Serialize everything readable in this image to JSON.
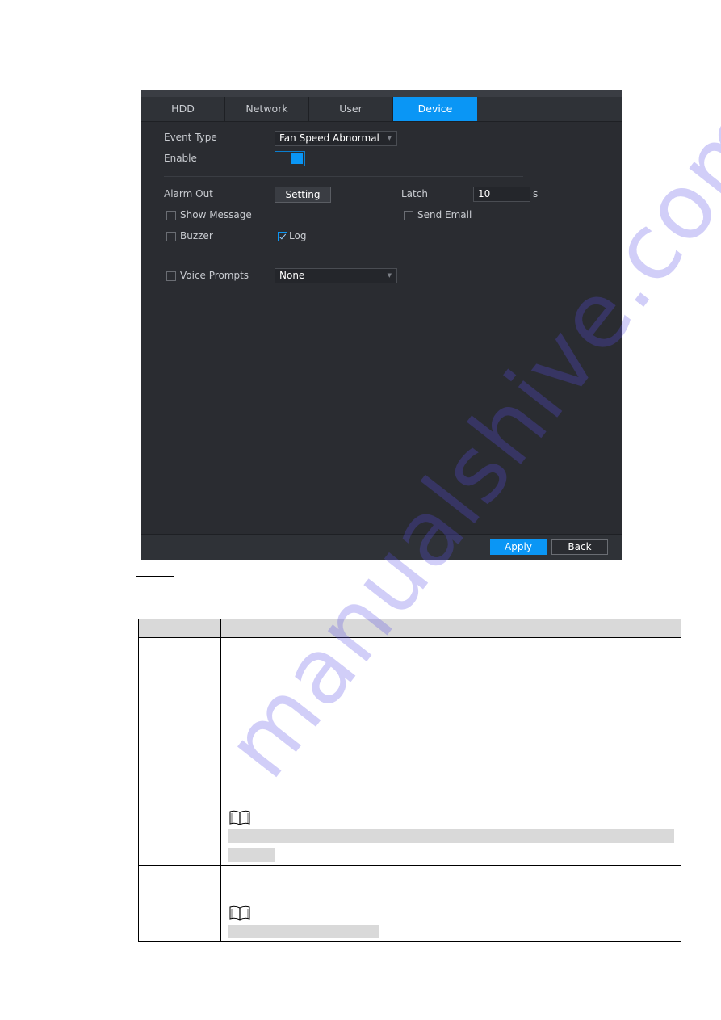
{
  "tabs": [
    {
      "label": "HDD",
      "active": false
    },
    {
      "label": "Network",
      "active": false
    },
    {
      "label": "User",
      "active": false
    },
    {
      "label": "Device",
      "active": true
    }
  ],
  "form": {
    "event_type_label": "Event Type",
    "event_type_value": "Fan Speed Abnormal",
    "enable_label": "Enable",
    "enable_on": true,
    "alarm_out_label": "Alarm Out",
    "setting_button": "Setting",
    "latch_label": "Latch",
    "latch_value": "10",
    "latch_unit": "s",
    "show_message_label": "Show Message",
    "show_message_checked": false,
    "send_email_label": "Send Email",
    "send_email_checked": false,
    "buzzer_label": "Buzzer",
    "buzzer_checked": false,
    "log_label": "Log",
    "log_checked": true,
    "voice_prompts_label": "Voice Prompts",
    "voice_prompts_checked": false,
    "voice_prompts_value": "None"
  },
  "footer": {
    "apply_label": "Apply",
    "back_label": "Back"
  },
  "colors": {
    "accent": "#0a96f5",
    "panel_bg": "#2a2c31",
    "table_header_bg": "#d9d9d9"
  },
  "watermark": "manualshive.com"
}
